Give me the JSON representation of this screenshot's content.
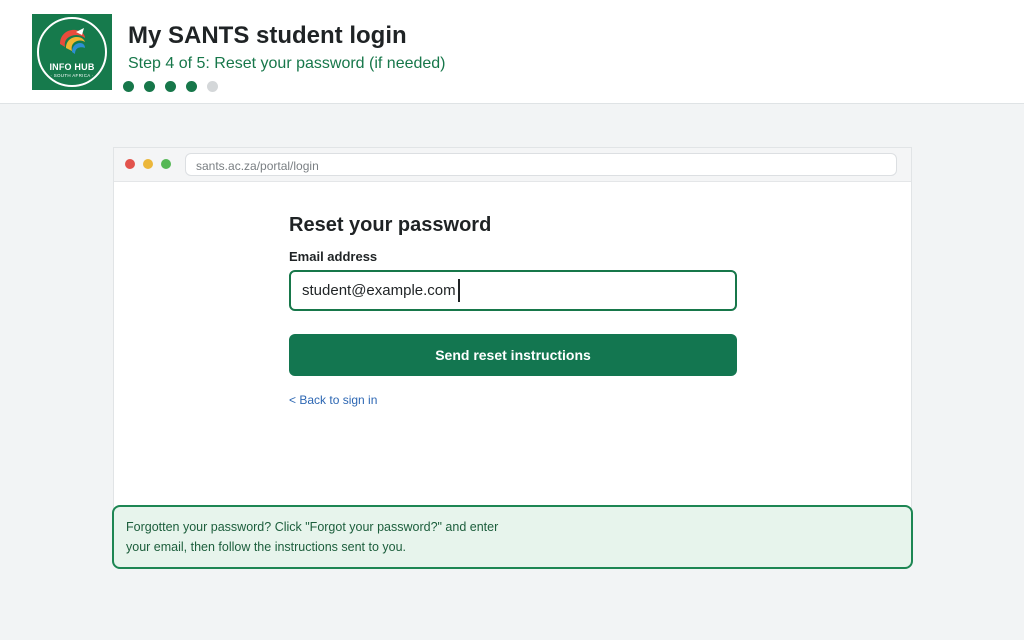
{
  "logo": {
    "text": "INFO HUB",
    "subtext": "· SOUTH AFRICA ·"
  },
  "header": {
    "title": "My SANTS student login",
    "subtitle": "Step 4 of 5: Reset your password (if needed)",
    "progress": {
      "current_step": 4,
      "total_steps": 5
    }
  },
  "browser": {
    "url": "sants.ac.za/portal/login"
  },
  "form": {
    "title": "Reset your password",
    "email_label": "Email address",
    "email_value": "student@example.com",
    "submit_label": "Send reset instructions",
    "back_link": "< Back to sign in"
  },
  "tip": {
    "line1": "Forgotten your password? Click \"Forgot your password?\" and enter",
    "line2": "your email, then follow the instructions sent to you."
  },
  "colors": {
    "brand_green": "#17774a",
    "button_green": "#137650",
    "link_blue": "#2d67b3",
    "tip_background": "#e7f4ec"
  }
}
